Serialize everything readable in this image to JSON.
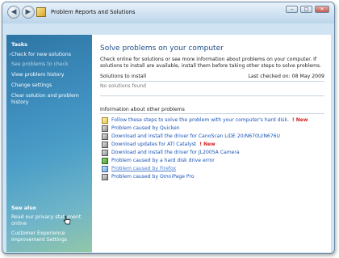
{
  "window": {
    "title": "Problem Reports and Solutions"
  },
  "titlebar": {
    "minimize": "‒",
    "maximize": "□",
    "close": "✕"
  },
  "sidebar": {
    "tasks_title": "Tasks",
    "tasks": [
      {
        "label": "Check for new solutions",
        "state": "active"
      },
      {
        "label": "See problems to check",
        "state": "disabled"
      },
      {
        "label": "View problem history",
        "state": "normal"
      },
      {
        "label": "Change settings",
        "state": "normal"
      },
      {
        "label": "Clear solution and problem history",
        "state": "normal"
      }
    ],
    "see_also_title": "See also",
    "see_also": [
      {
        "label": "Read our privacy statement online"
      },
      {
        "label": "Customer Experience Improvement Settings"
      }
    ]
  },
  "main": {
    "title": "Solve problems on your computer",
    "intro": "Check online for solutions or see more information about problems on your computer. If solutions to install are available, install them before taking other steps to solve problems.",
    "solutions_label": "Solutions to install",
    "last_checked": "Last checked on: 08 May 2009",
    "no_solutions": "No solutions found",
    "info_title": "Information about other problems",
    "problems": [
      {
        "label": "Follow these steps to solve the problem with your computer's hard disk.",
        "new": "! New",
        "icon": "folder-icon"
      },
      {
        "label": "Problem caused by Quicken",
        "new": "",
        "icon": "app-icon"
      },
      {
        "label": "Download and install the driver for CanoScan LiDE 20/N670U/N676U",
        "new": "",
        "icon": "download-icon"
      },
      {
        "label": "Download updates for ATI Catalyst",
        "new": "! New",
        "icon": "download-icon"
      },
      {
        "label": "Download and install the driver for JL2005A Camera",
        "new": "",
        "icon": "download-icon"
      },
      {
        "label": "Problem caused by a hard disk drive error",
        "new": "",
        "icon": "disk-icon"
      },
      {
        "label": "Problem caused by Firefox",
        "new": "",
        "icon": "app-icon"
      },
      {
        "label": "Problem caused by OmniPage Pro",
        "new": "",
        "icon": "app-icon"
      }
    ]
  }
}
